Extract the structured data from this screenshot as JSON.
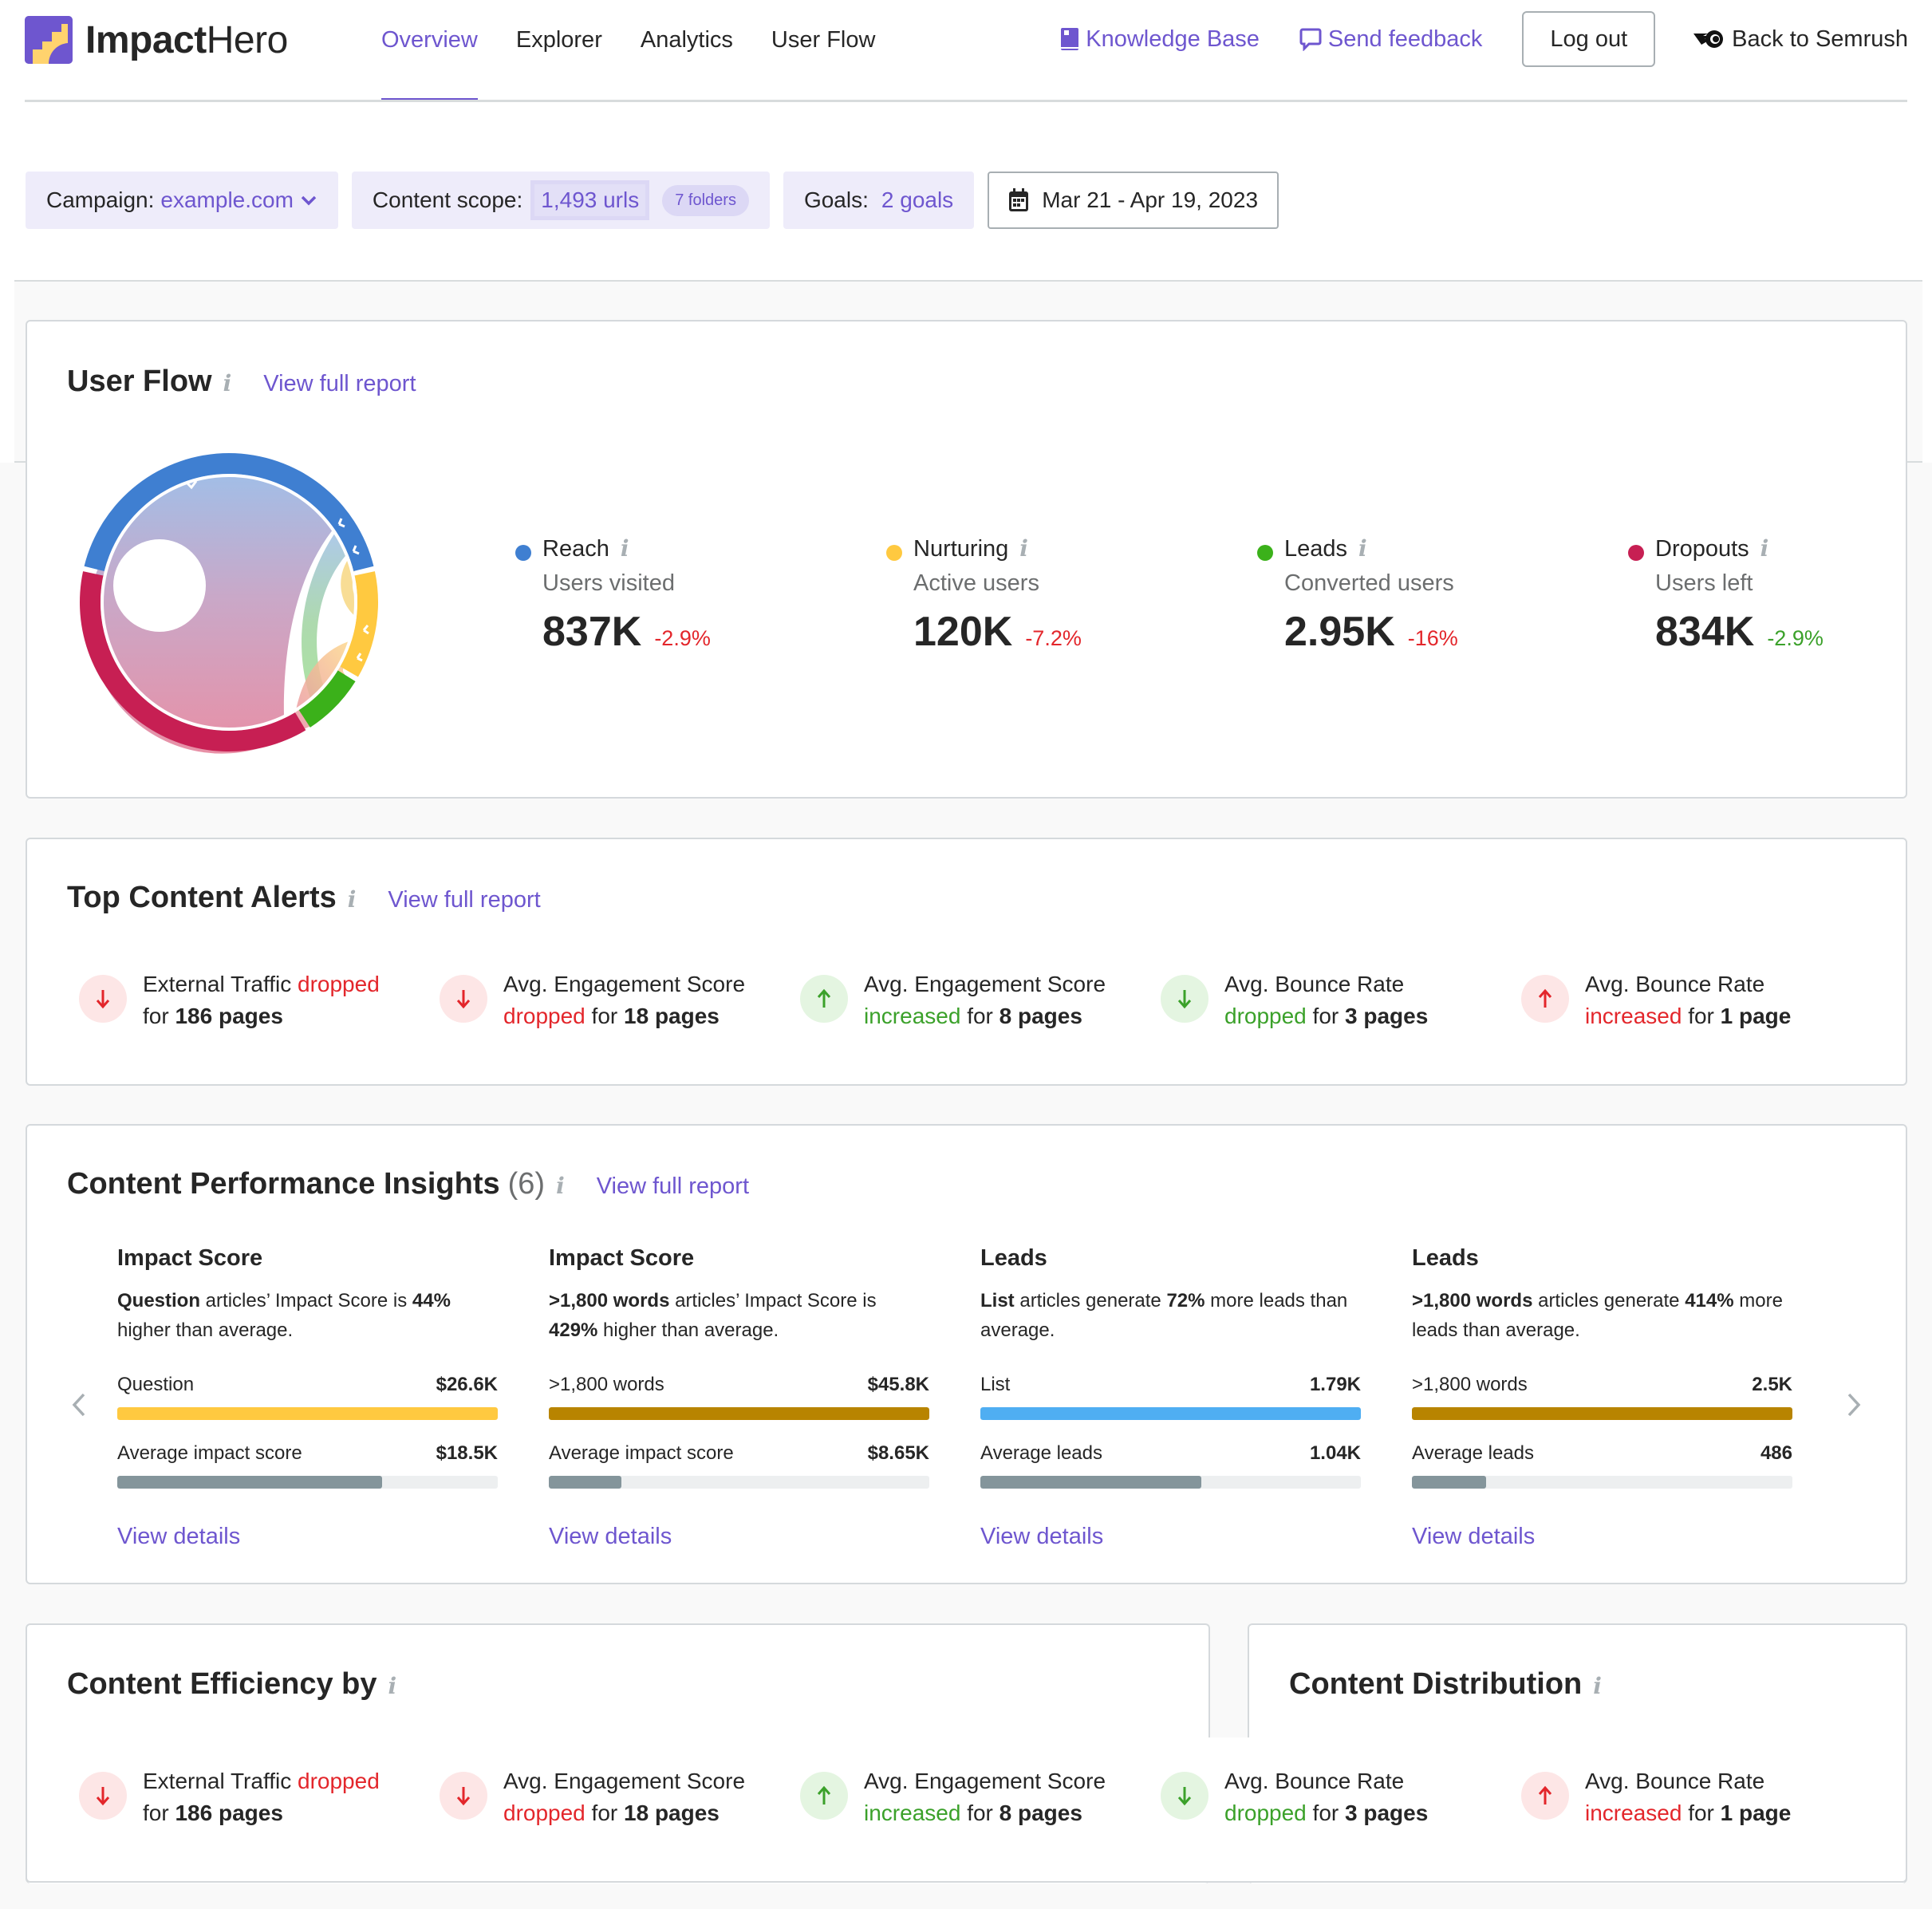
{
  "header": {
    "logo": {
      "bold": "Impact",
      "light": "Hero",
      "icon": "impact-hero-logo"
    },
    "nav": [
      {
        "label": "Overview",
        "active": true
      },
      {
        "label": "Explorer",
        "active": false
      },
      {
        "label": "Analytics",
        "active": false
      },
      {
        "label": "User Flow",
        "active": false
      }
    ],
    "knowledge_base": {
      "label": "Knowledge Base",
      "icon": "book-icon"
    },
    "send_feedback": {
      "label": "Send feedback",
      "icon": "speech-bubble-icon"
    },
    "logout": "Log out",
    "back_to_semrush": {
      "label": "Back to Semrush",
      "icon": "semrush-icon"
    }
  },
  "filters": {
    "campaign": {
      "label": "Campaign:",
      "value": "example.com"
    },
    "content_scope": {
      "label": "Content scope:",
      "value": "1,493 urls",
      "badge": "7 folders"
    },
    "goals": {
      "label": "Goals:",
      "value": "2 goals"
    },
    "date_range": {
      "value": "Mar 21 - Apr 19, 2023",
      "icon": "calendar-icon"
    }
  },
  "colors": {
    "accent": "#6e56cf",
    "reach": "#3f7fd1",
    "nurturing": "#ffc940",
    "leads": "#3bb11a",
    "dropouts": "#c71f53",
    "negative": "#e3262b",
    "positive": "#3ba12a"
  },
  "user_flow": {
    "title": "User Flow",
    "link": "View full report",
    "metrics": [
      {
        "name": "Reach",
        "sub": "Users visited",
        "value": "837K",
        "delta": "-2.9%",
        "delta_sign": "neg",
        "color": "#3f7fd1"
      },
      {
        "name": "Nurturing",
        "sub": "Active users",
        "value": "120K",
        "delta": "-7.2%",
        "delta_sign": "neg",
        "color": "#ffc940"
      },
      {
        "name": "Leads",
        "sub": "Converted users",
        "value": "2.95K",
        "delta": "-16%",
        "delta_sign": "neg",
        "color": "#3bb11a"
      },
      {
        "name": "Dropouts",
        "sub": "Users left",
        "value": "834K",
        "delta": "-2.9%",
        "delta_sign": "pos",
        "color": "#c71f53"
      }
    ]
  },
  "top_alerts": {
    "title": "Top Content Alerts",
    "link": "View full report",
    "items": [
      {
        "direction": "down",
        "tone": "red",
        "metric": "External Traffic",
        "verb": "dropped",
        "mid": "for",
        "count": "186 pages"
      },
      {
        "direction": "down",
        "tone": "red",
        "metric": "Avg. Engagement Score",
        "verb": "dropped",
        "mid": "for",
        "count": "18 pages"
      },
      {
        "direction": "up",
        "tone": "green",
        "metric": "Avg. Engagement Score",
        "verb": "increased",
        "mid": "for",
        "count": "8 pages"
      },
      {
        "direction": "down",
        "tone": "green",
        "metric": "Avg. Bounce Rate",
        "verb": "dropped",
        "mid": "for",
        "count": "3 pages"
      },
      {
        "direction": "up",
        "tone": "red",
        "metric": "Avg. Bounce Rate",
        "verb": "increased",
        "mid": "for",
        "count": "1 page"
      }
    ]
  },
  "insights": {
    "title": "Content Performance Insights",
    "count": "(6)",
    "link": "View full report",
    "items": [
      {
        "heading": "Impact Score",
        "desc_bold1": "Question",
        "desc_text1": " articles’ Impact Score is ",
        "desc_bold2": "44%",
        "desc_text2": " higher than average.",
        "primary": {
          "label": "Question",
          "value": "$26.6K",
          "fraction": 1.0,
          "color": "#ffc940"
        },
        "average": {
          "label": "Average impact score",
          "value": "$18.5K",
          "fraction": 0.695,
          "color": "#84959b"
        },
        "link": "View details"
      },
      {
        "heading": "Impact Score",
        "desc_bold1": ">1,800 words",
        "desc_text1": " articles’ Impact Score is ",
        "desc_bold2": "429%",
        "desc_text2": " higher than average.",
        "primary": {
          "label": ">1,800 words",
          "value": "$45.8K",
          "fraction": 1.0,
          "color": "#b88400"
        },
        "average": {
          "label": "Average impact score",
          "value": "$8.65K",
          "fraction": 0.19,
          "color": "#84959b"
        },
        "link": "View details"
      },
      {
        "heading": "Leads",
        "desc_bold1": "List",
        "desc_text1": " articles generate ",
        "desc_bold2": "72%",
        "desc_text2": " more leads than average.",
        "primary": {
          "label": "List",
          "value": "1.79K",
          "fraction": 1.0,
          "color": "#4faef2"
        },
        "average": {
          "label": "Average leads",
          "value": "1.04K",
          "fraction": 0.58,
          "color": "#84959b"
        },
        "link": "View details"
      },
      {
        "heading": "Leads",
        "desc_bold1": ">1,800 words",
        "desc_text1": " articles generate ",
        "desc_bold2": "414%",
        "desc_text2": " more leads than average.",
        "primary": {
          "label": ">1,800 words",
          "value": "2.5K",
          "fraction": 1.0,
          "color": "#b88400"
        },
        "average": {
          "label": "Average leads",
          "value": "486",
          "fraction": 0.195,
          "color": "#84959b"
        },
        "link": "View details"
      }
    ]
  },
  "efficiency": {
    "title": "Content Efficiency by"
  },
  "distribution": {
    "title": "Content Distribution"
  },
  "bottom_alerts": {
    "items": [
      {
        "direction": "down",
        "tone": "red",
        "metric": "External Traffic",
        "verb": "dropped",
        "mid": "for",
        "count": "186 pages"
      },
      {
        "direction": "down",
        "tone": "red",
        "metric": "Avg. Engagement Score",
        "verb": "dropped",
        "mid": "for",
        "count": "18 pages"
      },
      {
        "direction": "up",
        "tone": "green",
        "metric": "Avg. Engagement Score",
        "verb": "increased",
        "mid": "for",
        "count": "8 pages"
      },
      {
        "direction": "down",
        "tone": "green",
        "metric": "Avg. Bounce Rate",
        "verb": "dropped",
        "mid": "for",
        "count": "3 pages"
      },
      {
        "direction": "up",
        "tone": "red",
        "metric": "Avg. Bounce Rate",
        "verb": "increased",
        "mid": "for",
        "count": "1 page"
      }
    ]
  }
}
